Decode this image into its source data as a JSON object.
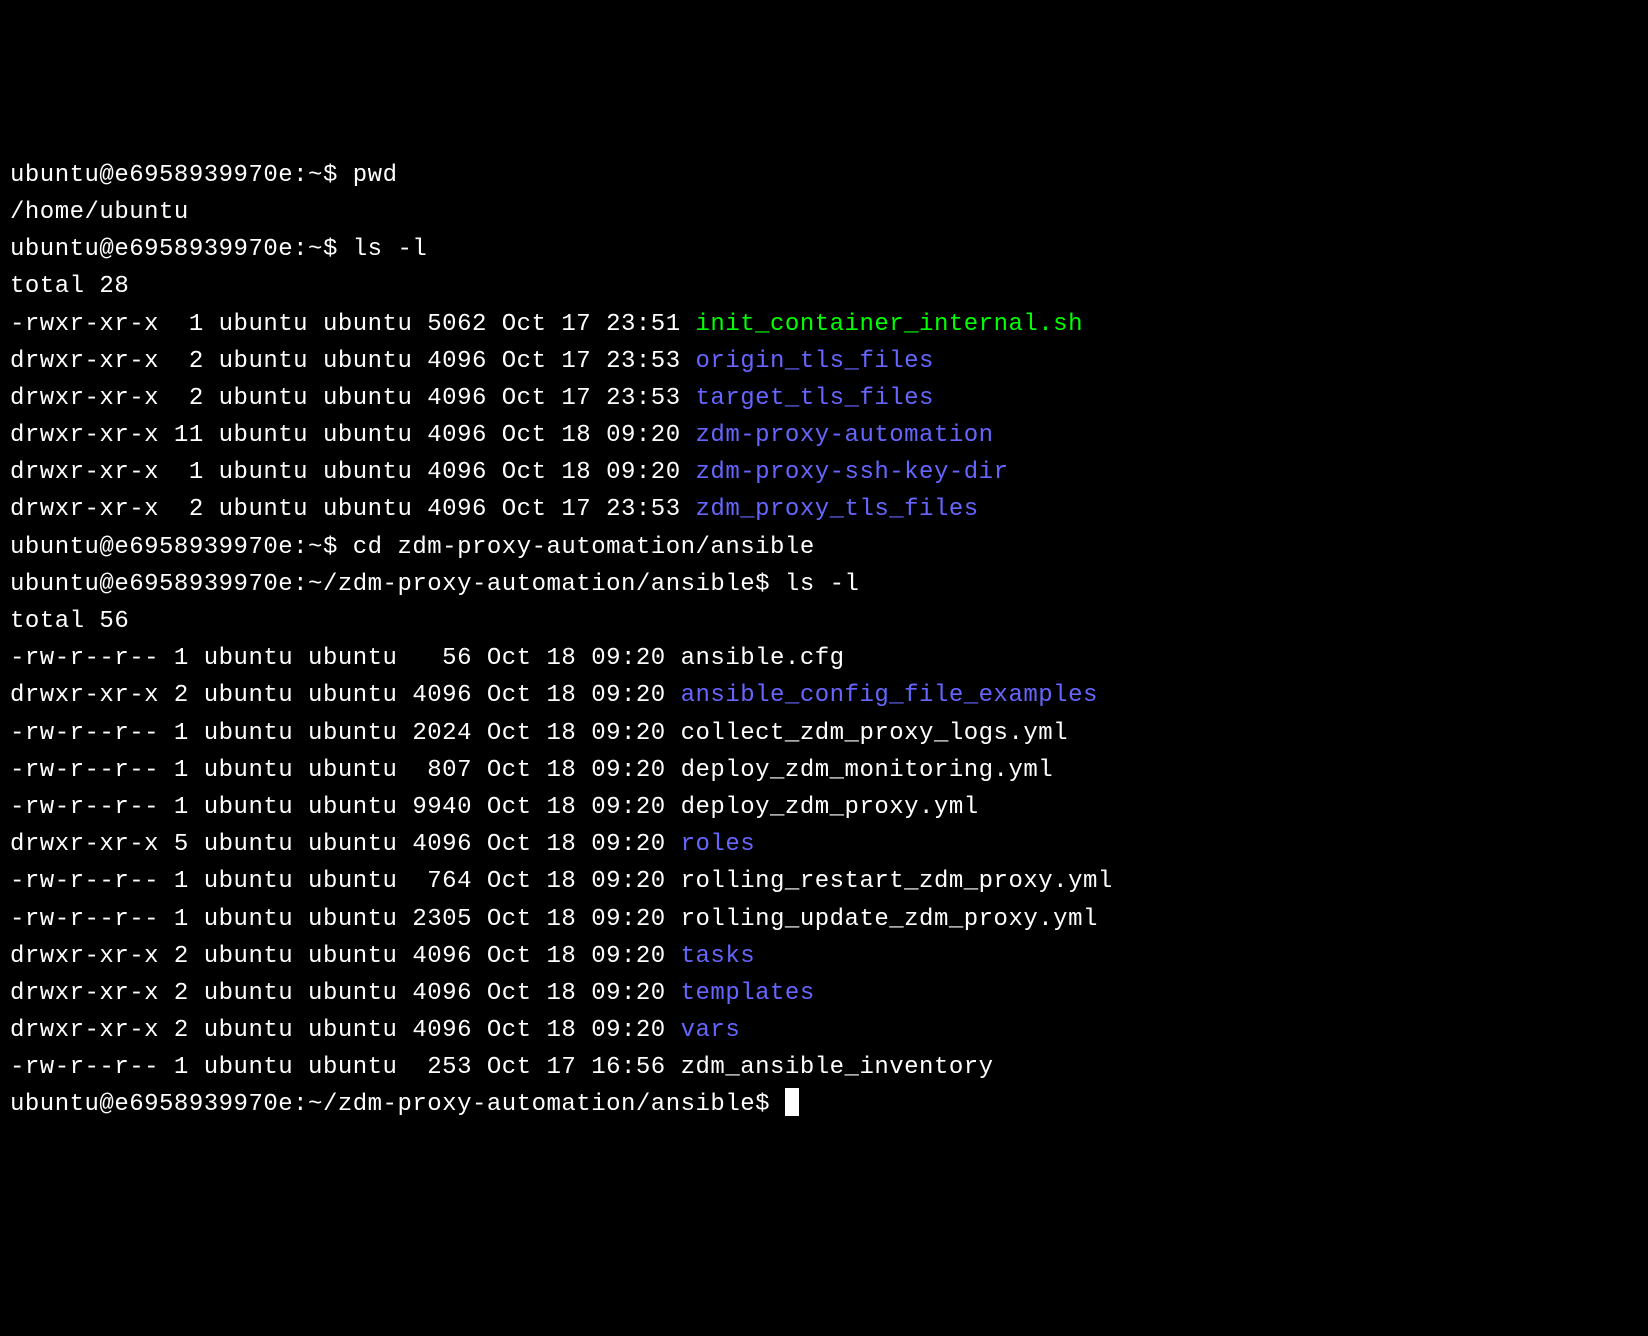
{
  "prompts": {
    "home": "ubuntu@e6958939970e:~$ ",
    "ansible": "ubuntu@e6958939970e:~/zdm-proxy-automation/ansible$ "
  },
  "commands": {
    "pwd": "pwd",
    "lsl": "ls -l",
    "cd": "cd zdm-proxy-automation/ansible"
  },
  "pwd_output": "/home/ubuntu",
  "home_ls": {
    "total": "total 28",
    "entries": [
      {
        "perms": "-rwxr-xr-x",
        "links": " 1",
        "owner": "ubuntu",
        "group": "ubuntu",
        "size": "5062",
        "date": "Oct 17 23:51",
        "name": "init_container_internal.sh",
        "type": "exec"
      },
      {
        "perms": "drwxr-xr-x",
        "links": " 2",
        "owner": "ubuntu",
        "group": "ubuntu",
        "size": "4096",
        "date": "Oct 17 23:53",
        "name": "origin_tls_files",
        "type": "dir"
      },
      {
        "perms": "drwxr-xr-x",
        "links": " 2",
        "owner": "ubuntu",
        "group": "ubuntu",
        "size": "4096",
        "date": "Oct 17 23:53",
        "name": "target_tls_files",
        "type": "dir"
      },
      {
        "perms": "drwxr-xr-x",
        "links": "11",
        "owner": "ubuntu",
        "group": "ubuntu",
        "size": "4096",
        "date": "Oct 18 09:20",
        "name": "zdm-proxy-automation",
        "type": "dir"
      },
      {
        "perms": "drwxr-xr-x",
        "links": " 1",
        "owner": "ubuntu",
        "group": "ubuntu",
        "size": "4096",
        "date": "Oct 18 09:20",
        "name": "zdm-proxy-ssh-key-dir",
        "type": "dir"
      },
      {
        "perms": "drwxr-xr-x",
        "links": " 2",
        "owner": "ubuntu",
        "group": "ubuntu",
        "size": "4096",
        "date": "Oct 17 23:53",
        "name": "zdm_proxy_tls_files",
        "type": "dir"
      }
    ]
  },
  "ansible_ls": {
    "total": "total 56",
    "entries": [
      {
        "perms": "-rw-r--r--",
        "links": "1",
        "owner": "ubuntu",
        "group": "ubuntu",
        "size": "  56",
        "date": "Oct 18 09:20",
        "name": "ansible.cfg",
        "type": "file"
      },
      {
        "perms": "drwxr-xr-x",
        "links": "2",
        "owner": "ubuntu",
        "group": "ubuntu",
        "size": "4096",
        "date": "Oct 18 09:20",
        "name": "ansible_config_file_examples",
        "type": "dir"
      },
      {
        "perms": "-rw-r--r--",
        "links": "1",
        "owner": "ubuntu",
        "group": "ubuntu",
        "size": "2024",
        "date": "Oct 18 09:20",
        "name": "collect_zdm_proxy_logs.yml",
        "type": "file"
      },
      {
        "perms": "-rw-r--r--",
        "links": "1",
        "owner": "ubuntu",
        "group": "ubuntu",
        "size": " 807",
        "date": "Oct 18 09:20",
        "name": "deploy_zdm_monitoring.yml",
        "type": "file"
      },
      {
        "perms": "-rw-r--r--",
        "links": "1",
        "owner": "ubuntu",
        "group": "ubuntu",
        "size": "9940",
        "date": "Oct 18 09:20",
        "name": "deploy_zdm_proxy.yml",
        "type": "file"
      },
      {
        "perms": "drwxr-xr-x",
        "links": "5",
        "owner": "ubuntu",
        "group": "ubuntu",
        "size": "4096",
        "date": "Oct 18 09:20",
        "name": "roles",
        "type": "dir"
      },
      {
        "perms": "-rw-r--r--",
        "links": "1",
        "owner": "ubuntu",
        "group": "ubuntu",
        "size": " 764",
        "date": "Oct 18 09:20",
        "name": "rolling_restart_zdm_proxy.yml",
        "type": "file"
      },
      {
        "perms": "-rw-r--r--",
        "links": "1",
        "owner": "ubuntu",
        "group": "ubuntu",
        "size": "2305",
        "date": "Oct 18 09:20",
        "name": "rolling_update_zdm_proxy.yml",
        "type": "file"
      },
      {
        "perms": "drwxr-xr-x",
        "links": "2",
        "owner": "ubuntu",
        "group": "ubuntu",
        "size": "4096",
        "date": "Oct 18 09:20",
        "name": "tasks",
        "type": "dir"
      },
      {
        "perms": "drwxr-xr-x",
        "links": "2",
        "owner": "ubuntu",
        "group": "ubuntu",
        "size": "4096",
        "date": "Oct 18 09:20",
        "name": "templates",
        "type": "dir"
      },
      {
        "perms": "drwxr-xr-x",
        "links": "2",
        "owner": "ubuntu",
        "group": "ubuntu",
        "size": "4096",
        "date": "Oct 18 09:20",
        "name": "vars",
        "type": "dir"
      },
      {
        "perms": "-rw-r--r--",
        "links": "1",
        "owner": "ubuntu",
        "group": "ubuntu",
        "size": " 253",
        "date": "Oct 17 16:56",
        "name": "zdm_ansible_inventory",
        "type": "file"
      }
    ]
  }
}
